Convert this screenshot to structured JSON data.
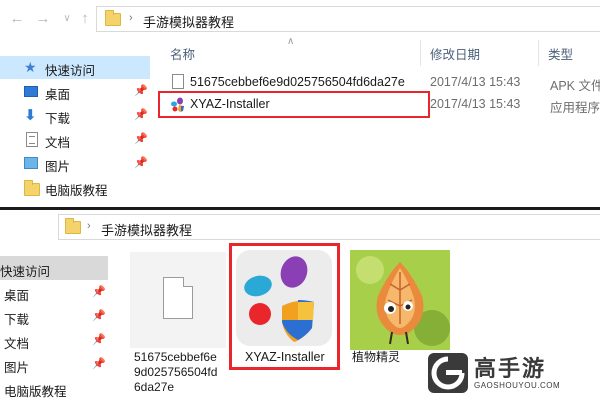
{
  "top_window": {
    "breadcrumb": "手游模拟器教程",
    "columns": {
      "name": "名称",
      "date": "修改日期",
      "type": "类型"
    },
    "sidebar": [
      {
        "label": "快速访问",
        "icon": "star-icon",
        "selected": true
      },
      {
        "label": "桌面",
        "icon": "desktop-icon",
        "pinned": true
      },
      {
        "label": "下载",
        "icon": "download-icon",
        "pinned": true
      },
      {
        "label": "文档",
        "icon": "document-icon",
        "pinned": true
      },
      {
        "label": "图片",
        "icon": "pictures-icon",
        "pinned": true
      },
      {
        "label": "电脑版教程",
        "icon": "folder-icon"
      }
    ],
    "files": [
      {
        "name": "51675cebbef6e9d025756504fd6da27e",
        "date": "2017/4/13 15:43",
        "type": "APK 文件",
        "icon": "file-icon"
      },
      {
        "name": "XYAZ-Installer",
        "date": "2017/4/13 15:43",
        "type": "应用程序",
        "icon": "app-icon",
        "highlighted": true
      }
    ]
  },
  "bottom_window": {
    "breadcrumb": "手游模拟器教程",
    "sidebar": [
      {
        "label": "快速访问",
        "selected": true
      },
      {
        "label": "桌面",
        "pinned": true
      },
      {
        "label": "下载",
        "pinned": true
      },
      {
        "label": "文档",
        "pinned": true
      },
      {
        "label": "图片",
        "pinned": true
      },
      {
        "label": "电脑版教程"
      }
    ],
    "tiles": [
      {
        "caption_lines": [
          "51675cebbef6e",
          "9d025756504fd",
          "6da27e"
        ],
        "icon": "blank-file-icon"
      },
      {
        "caption_lines": [
          "XYAZ-Installer"
        ],
        "icon": "installer-icon",
        "highlighted": true
      },
      {
        "caption_lines": [
          "植物精灵"
        ],
        "icon": "plant-spirit-icon"
      }
    ]
  },
  "watermark": {
    "title": "高手游",
    "subtitle": "GAOSHOUYOU.COM"
  },
  "colors": {
    "highlight": "#e8262b",
    "selection": "#cce8ff",
    "accent": "#2f7ad6"
  }
}
